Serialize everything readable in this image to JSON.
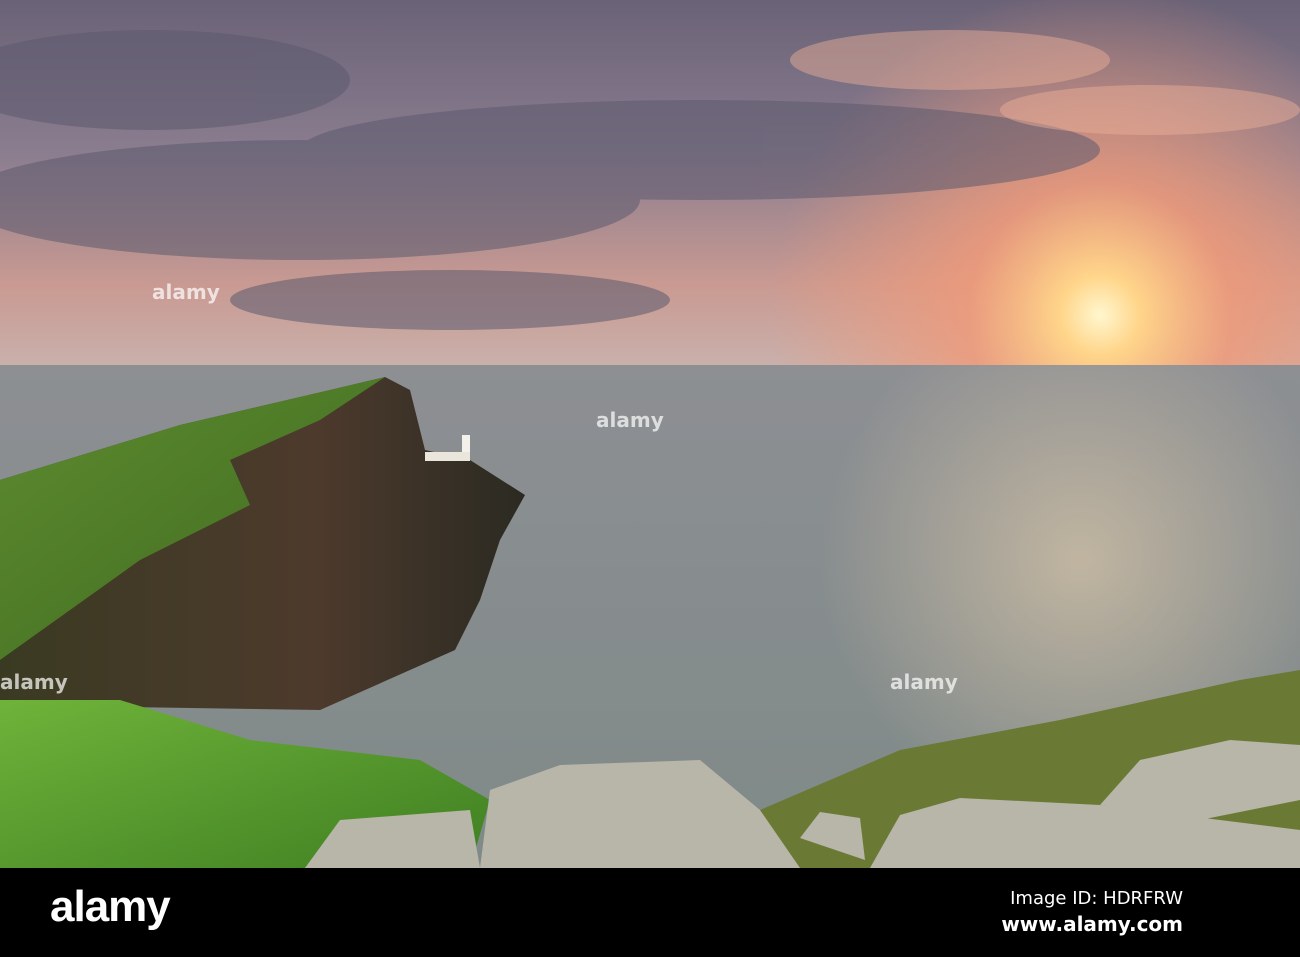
{
  "photo": {
    "subject": "Neist Point lighthouse sea cliffs at sunset"
  },
  "footer": {
    "logo": "alamy",
    "image_id": "Image ID: HDRFRW",
    "url": "www.alamy.com"
  },
  "colors": {
    "sun": "#fff3c0",
    "sky_top": "#6e6478",
    "sea": "#8a908c",
    "grass": "#5f9a2a",
    "bar": "#000000"
  }
}
